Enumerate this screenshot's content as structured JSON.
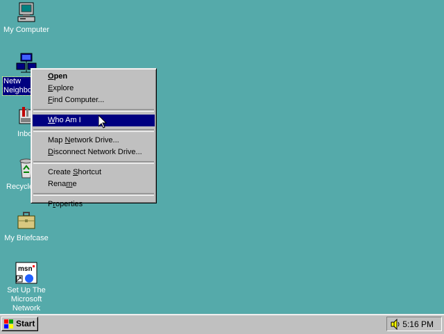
{
  "desktop": {
    "icons": [
      {
        "label": "My Computer",
        "icon": "my-computer-icon"
      },
      {
        "label": "Network Neighborhood",
        "icon": "network-neighborhood-icon",
        "visible_text": "Netw\nNeighbo",
        "selected": true
      },
      {
        "label": "Inbox",
        "icon": "inbox-icon",
        "visible_text": "Inbo"
      },
      {
        "label": "Recycle Bin",
        "icon": "recycle-bin-icon",
        "visible_text": "Recycle"
      },
      {
        "label": "My Briefcase",
        "icon": "briefcase-icon"
      },
      {
        "label": "Set Up The Microsoft Network",
        "icon": "msn-icon"
      }
    ]
  },
  "context_menu": {
    "items": [
      {
        "label": "Open",
        "accel": "O",
        "bold": true
      },
      {
        "label": "Explore",
        "accel": "E"
      },
      {
        "label": "Find Computer...",
        "accel": "F"
      },
      {
        "separator": true
      },
      {
        "label": "Who Am I",
        "accel": "W",
        "highlighted": true
      },
      {
        "separator": true
      },
      {
        "label": "Map Network Drive...",
        "accel": "N"
      },
      {
        "label": "Disconnect Network Drive...",
        "accel": "D"
      },
      {
        "separator": true
      },
      {
        "label": "Create Shortcut",
        "accel": "S"
      },
      {
        "label": "Rename",
        "accel": "m"
      },
      {
        "separator": true
      },
      {
        "label": "Properties",
        "accel": "r"
      }
    ]
  },
  "taskbar": {
    "start_label": "Start",
    "clock": "5:16 PM",
    "tray_icon": "speaker-icon"
  },
  "colors": {
    "desktop": "#55aaaa",
    "highlight": "#000080",
    "face": "#c0c0c0"
  }
}
